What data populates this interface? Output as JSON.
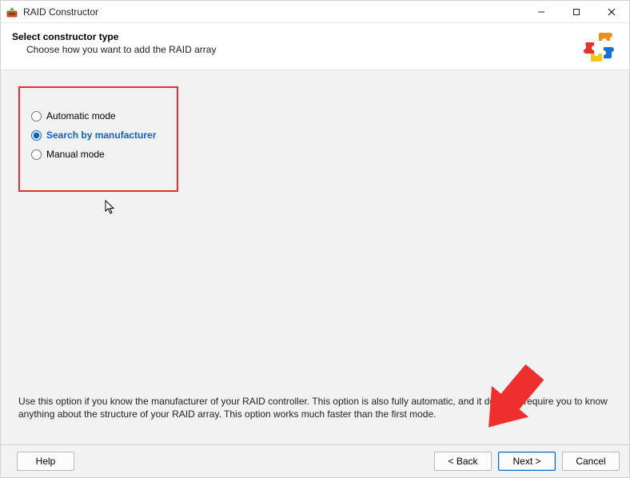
{
  "window": {
    "title": "RAID Constructor",
    "controls": {
      "min": "—",
      "max": "▢",
      "close": "✕"
    }
  },
  "header": {
    "title": "Select constructor type",
    "subtitle": "Choose how you want to add the RAID array"
  },
  "options": [
    {
      "id": "auto",
      "label": "Automatic mode",
      "selected": false
    },
    {
      "id": "manuf",
      "label": "Search by manufacturer",
      "selected": true
    },
    {
      "id": "manual",
      "label": "Manual mode",
      "selected": false
    }
  ],
  "description": "Use this option if you know the manufacturer of your RAID controller. This option is also fully automatic, and it does not require you to know anything about the structure of your RAID array. This option works much faster than the first mode.",
  "footer": {
    "help": "Help",
    "back": "< Back",
    "next": "Next >",
    "cancel": "Cancel"
  }
}
